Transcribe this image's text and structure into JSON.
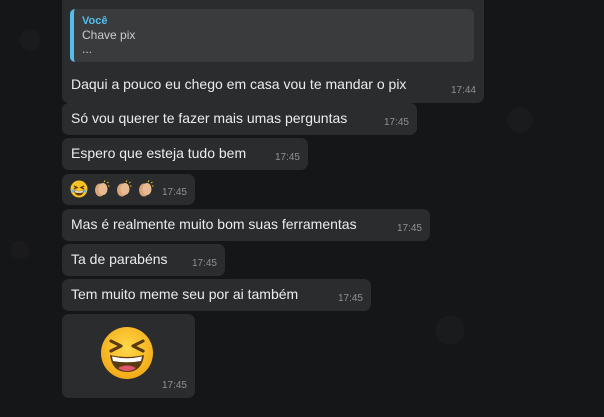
{
  "messages": [
    {
      "quote": {
        "author": "Você",
        "line1": "Chave pix",
        "line2": "..."
      },
      "text": "Daqui a pouco eu chego em casa vou te mandar o pix",
      "time": "17:44"
    },
    {
      "text": "Só vou querer te fazer mais umas perguntas",
      "time": "17:45"
    },
    {
      "text": "Espero que esteja tudo bem",
      "time": "17:45"
    },
    {
      "emojis": [
        "grinning-squinting-face-emoji",
        "clapping-hands-emoji",
        "clapping-hands-emoji",
        "clapping-hands-emoji"
      ],
      "time": "17:45"
    },
    {
      "text": "Mas é realmente muito bom suas ferramentas",
      "time": "17:45"
    },
    {
      "text": "Ta de parabéns",
      "time": "17:45"
    },
    {
      "text": "Tem muito meme seu por ai também",
      "time": "17:45"
    },
    {
      "sticker": "grinning-squinting-face-emoji",
      "time": "17:45"
    }
  ],
  "colors": {
    "background": "#151617",
    "bubble": "#2b2c2d",
    "quote_accent": "#53bdeb",
    "timestamp": "#8d9193"
  }
}
